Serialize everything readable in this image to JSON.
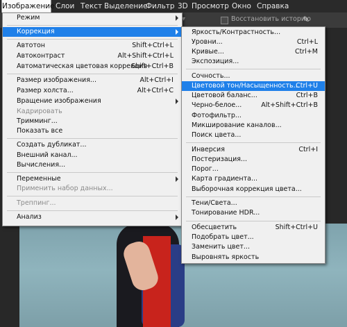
{
  "menubar": [
    "Изображение",
    "Слои",
    "Текст",
    "Выделение",
    "Фильтр",
    "3D",
    "Просмотр",
    "Окно",
    "Справка"
  ],
  "optbar": {
    "restore_history": "Восстановить историю"
  },
  "image_menu": {
    "items": [
      {
        "label": "Режим",
        "shortcut": "",
        "submenu": true
      },
      {
        "label": "Коррекция",
        "shortcut": "",
        "submenu": true,
        "highlighted": true
      },
      {
        "label": "Автотон",
        "shortcut": "Shift+Ctrl+L"
      },
      {
        "label": "Автоконтраст",
        "shortcut": "Alt+Shift+Ctrl+L"
      },
      {
        "label": "Автоматическая цветовая коррекция",
        "shortcut": "Shift+Ctrl+B"
      },
      {
        "label": "Размер изображения...",
        "shortcut": "Alt+Ctrl+I"
      },
      {
        "label": "Размер холста...",
        "shortcut": "Alt+Ctrl+C"
      },
      {
        "label": "Вращение изображения",
        "shortcut": "",
        "submenu": true
      },
      {
        "label": "Кадрировать",
        "shortcut": "",
        "disabled": true
      },
      {
        "label": "Тримминг...",
        "shortcut": ""
      },
      {
        "label": "Показать все",
        "shortcut": ""
      },
      {
        "label": "Создать дубликат...",
        "shortcut": ""
      },
      {
        "label": "Внешний канал...",
        "shortcut": ""
      },
      {
        "label": "Вычисления...",
        "shortcut": ""
      },
      {
        "label": "Переменные",
        "shortcut": "",
        "submenu": true
      },
      {
        "label": "Применить набор данных...",
        "shortcut": "",
        "disabled": true
      },
      {
        "label": "Треппинг...",
        "shortcut": "",
        "disabled": true
      },
      {
        "label": "Анализ",
        "shortcut": "",
        "submenu": true
      }
    ]
  },
  "correction_menu": {
    "items": [
      {
        "label": "Яркость/Контрастность...",
        "shortcut": ""
      },
      {
        "label": "Уровни...",
        "shortcut": "Ctrl+L"
      },
      {
        "label": "Кривые...",
        "shortcut": "Ctrl+M"
      },
      {
        "label": "Экспозиция...",
        "shortcut": ""
      },
      {
        "label": "Сочность...",
        "shortcut": ""
      },
      {
        "label": "Цветовой тон/Насыщенность...",
        "shortcut": "Ctrl+U",
        "highlighted": true
      },
      {
        "label": "Цветовой баланс...",
        "shortcut": "Ctrl+B"
      },
      {
        "label": "Черно-белое...",
        "shortcut": "Alt+Shift+Ctrl+B"
      },
      {
        "label": "Фотофильтр...",
        "shortcut": ""
      },
      {
        "label": "Микширование каналов...",
        "shortcut": ""
      },
      {
        "label": "Поиск цвета...",
        "shortcut": ""
      },
      {
        "label": "Инверсия",
        "shortcut": "Ctrl+I"
      },
      {
        "label": "Постеризация...",
        "shortcut": ""
      },
      {
        "label": "Порог...",
        "shortcut": ""
      },
      {
        "label": "Карта градиента...",
        "shortcut": ""
      },
      {
        "label": "Выборочная коррекция цвета...",
        "shortcut": ""
      },
      {
        "label": "Тени/Света...",
        "shortcut": ""
      },
      {
        "label": "Тонирование HDR...",
        "shortcut": ""
      },
      {
        "label": "Обесцветить",
        "shortcut": "Shift+Ctrl+U"
      },
      {
        "label": "Подобрать цвет...",
        "shortcut": ""
      },
      {
        "label": "Заменить цвет...",
        "shortcut": ""
      },
      {
        "label": "Выровнять яркость",
        "shortcut": ""
      }
    ]
  }
}
